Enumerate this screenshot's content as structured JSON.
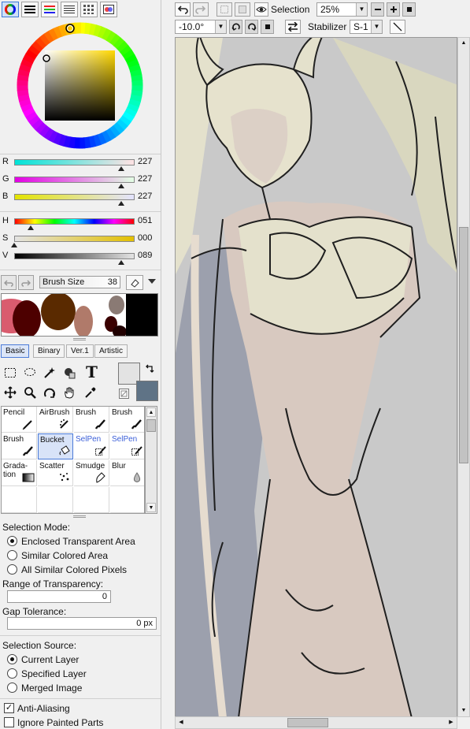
{
  "rgb": [
    {
      "label": "R",
      "value": "227",
      "gradient": "linear-gradient(90deg,#00e3d7,#ffe3e4)",
      "pos": 0.89
    },
    {
      "label": "G",
      "value": "227",
      "gradient": "linear-gradient(90deg,#e300e4,#e3ffe4)",
      "pos": 0.89
    },
    {
      "label": "B",
      "value": "227",
      "gradient": "linear-gradient(90deg,#e3e300,#e3e3ff)",
      "pos": 0.89
    }
  ],
  "hsv": [
    {
      "label": "H",
      "value": "051",
      "gradient": "linear-gradient(90deg,#f00,#ff0,#0f0,#0ff,#00f,#f0f,#f00)",
      "pos": 0.14
    },
    {
      "label": "S",
      "value": "000",
      "gradient": "linear-gradient(90deg,#e3e3e3,#e3c000)",
      "pos": 0.0
    },
    {
      "label": "V",
      "value": "089",
      "gradient": "linear-gradient(90deg,#000,#e3e3e3)",
      "pos": 0.89
    }
  ],
  "brush_size": {
    "label": "Brush Size",
    "value": "38"
  },
  "tool_tabs": [
    {
      "label": "Basic"
    },
    {
      "label": "Binary"
    },
    {
      "label": "Ver.1"
    },
    {
      "label": "Artistic"
    }
  ],
  "brushes": [
    {
      "label": "Pencil",
      "icon": "pencil-icon"
    },
    {
      "label": "AirBrush",
      "icon": "airbrush-icon"
    },
    {
      "label": "Brush",
      "icon": "brush-icon"
    },
    {
      "label": "Brush",
      "icon": "brush-icon"
    },
    {
      "label": "Brush",
      "icon": "brush-icon"
    },
    {
      "label": "Bucket",
      "icon": "bucket-icon"
    },
    {
      "label": "SelPen",
      "icon": "selpen-icon"
    },
    {
      "label": "SelPen",
      "icon": "selpen-icon"
    },
    {
      "label": "Grada-\ntion",
      "icon": "gradation-icon"
    },
    {
      "label": "Scatter",
      "icon": "scatter-icon"
    },
    {
      "label": "Smudge",
      "icon": "smudge-icon"
    },
    {
      "label": "Blur",
      "icon": "blur-icon"
    }
  ],
  "selection_mode": {
    "label": "Selection Mode:",
    "options": [
      "Enclosed Transparent Area",
      "Similar Colored Area",
      "All Similar Colored Pixels"
    ],
    "selected": 0
  },
  "range_of_transparency": {
    "label": "Range of Transparency:",
    "value": "0"
  },
  "gap_tolerance": {
    "label": "Gap Tolerance:",
    "value": "0 px"
  },
  "selection_source": {
    "label": "Selection Source:",
    "options": [
      "Current Layer",
      "Specified Layer",
      "Merged Image"
    ],
    "selected": 0
  },
  "anti_aliasing": {
    "label": "Anti-Aliasing",
    "checked": "✓"
  },
  "ignore_painted": {
    "label": "Ignore Painted Parts"
  },
  "toolbar": {
    "selection_label": "Selection",
    "zoom": "25%",
    "rotation": "-10.0°",
    "stabilizer_label": "Stabilizer",
    "stabilizer_value": "S-1"
  },
  "colors": {
    "primary": "#e3e3e3",
    "secondary": "#5f7386",
    "accent": "#3b78d8",
    "canvas_bg": "#c9c9c9"
  }
}
